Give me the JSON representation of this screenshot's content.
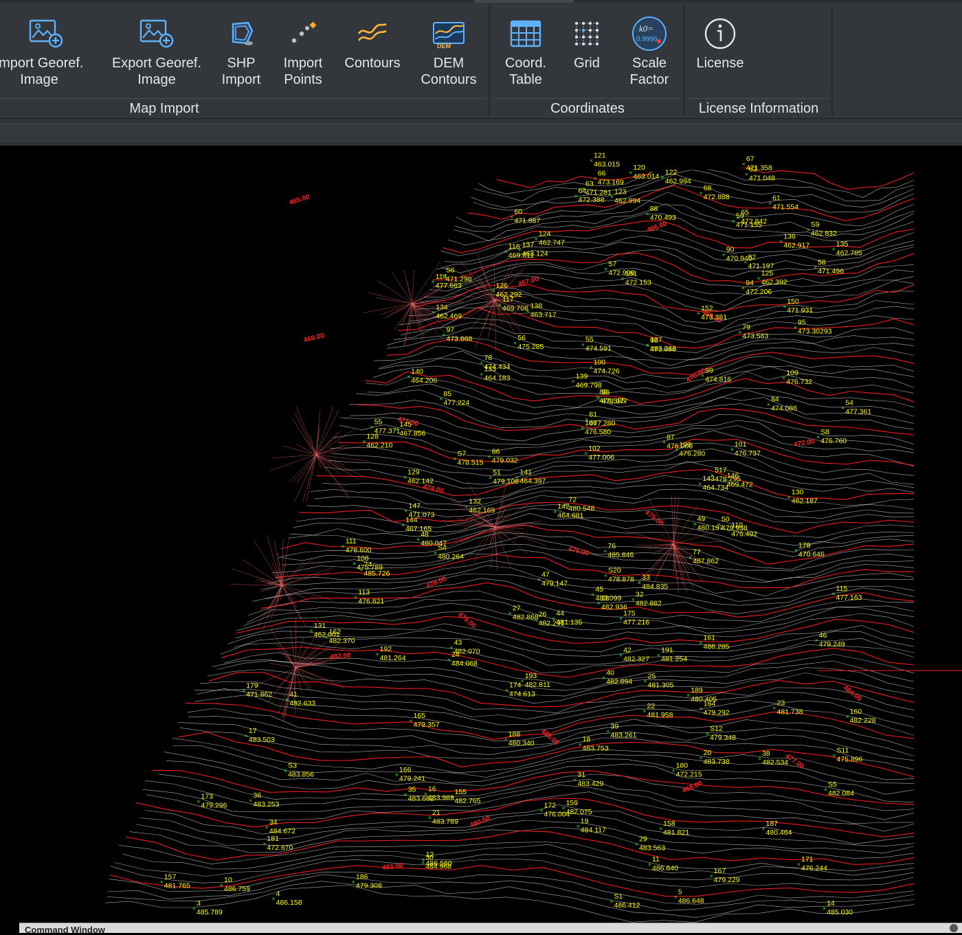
{
  "ribbon": {
    "map_import": {
      "group_label": "Map Import",
      "buttons": [
        {
          "label": "Import Georef.\nImage",
          "icon": "import-georef-image-icon"
        },
        {
          "label": "Export Georef.\nImage",
          "icon": "export-georef-image-icon"
        },
        {
          "label": "SHP\nImport",
          "icon": "shp-import-icon"
        },
        {
          "label": "Import\nPoints",
          "icon": "import-points-icon"
        },
        {
          "label": "Contours",
          "icon": "contours-icon"
        },
        {
          "label": "DEM\nContours",
          "icon": "dem-contours-icon",
          "badge": "DEM"
        }
      ]
    },
    "coordinates": {
      "group_label": "Coordinates",
      "buttons": [
        {
          "label": "Coord.\nTable",
          "icon": "table-icon"
        },
        {
          "label": "Grid",
          "icon": "grid-icon"
        },
        {
          "label": "Scale\nFactor",
          "icon": "scale-factor-icon",
          "badge_top": "k0=",
          "badge_bottom": "0.9996"
        }
      ]
    },
    "license": {
      "group_label": "License Information",
      "buttons": [
        {
          "label": "License",
          "icon": "info-icon"
        }
      ]
    }
  },
  "command_window": {
    "title": "Command Window"
  },
  "drawing": {
    "colors": {
      "point_label": "#ffff00",
      "contour_index": "#ff1f1f",
      "contour_minor": "#d9d9d9",
      "point_marker": "#22ff22",
      "background": "#000000"
    },
    "points": [
      {
        "id": "67",
        "elev": "471.358"
      },
      {
        "id": "121",
        "elev": "463.015"
      },
      {
        "id": "62",
        "elev": "471.048"
      },
      {
        "id": "122",
        "elev": "462.994"
      },
      {
        "id": "120",
        "elev": "463.014"
      },
      {
        "id": "66",
        "elev": "473.169"
      },
      {
        "id": "68",
        "elev": "472.888"
      },
      {
        "id": "63",
        "elev": "471.281"
      },
      {
        "id": "61",
        "elev": "471.554"
      },
      {
        "id": "123",
        "elev": "462.994"
      },
      {
        "id": "64",
        "elev": "472.388"
      },
      {
        "id": "88",
        "elev": "470.493"
      },
      {
        "id": "60",
        "elev": "471.887"
      },
      {
        "id": "59",
        "elev": "471.155"
      },
      {
        "id": "65",
        "elev": "472.842"
      },
      {
        "id": "124",
        "elev": "462.747"
      },
      {
        "id": "S9",
        "elev": "462.832"
      },
      {
        "id": "136",
        "elev": "462.917"
      },
      {
        "id": "135",
        "elev": "462.785"
      },
      {
        "id": "137",
        "elev": "463.124"
      },
      {
        "id": "116",
        "elev": "469.811"
      },
      {
        "id": "90",
        "elev": "470.940"
      },
      {
        "id": "58",
        "elev": "471.496"
      },
      {
        "id": "S6",
        "elev": "471.298"
      },
      {
        "id": "82",
        "elev": "471.197"
      },
      {
        "id": "57",
        "elev": "472.996"
      },
      {
        "id": "125",
        "elev": "462.392"
      },
      {
        "id": "151",
        "elev": "472.153"
      },
      {
        "id": "114",
        "elev": "477.663"
      },
      {
        "id": "94",
        "elev": "472.206"
      },
      {
        "id": "126",
        "elev": "462.292"
      },
      {
        "id": "134",
        "elev": "462.469"
      },
      {
        "id": "138",
        "elev": "463.717"
      },
      {
        "id": "117",
        "elev": "469.708"
      },
      {
        "id": "150",
        "elev": "471.931"
      },
      {
        "id": "152",
        "elev": "473.381"
      },
      {
        "id": "95",
        "elev": "473.30293"
      },
      {
        "id": "79",
        "elev": "473.583"
      },
      {
        "id": "56",
        "elev": "475.285"
      },
      {
        "id": "96",
        "elev": "473.058"
      },
      {
        "id": "97",
        "elev": "473.668"
      },
      {
        "id": "55",
        "elev": "474.591"
      },
      {
        "id": "127",
        "elev": "462.246"
      },
      {
        "id": "78",
        "elev": "474.434"
      },
      {
        "id": "100",
        "elev": "474.726"
      },
      {
        "id": "133",
        "elev": "464.183"
      },
      {
        "id": "139",
        "elev": "469.798"
      },
      {
        "id": "99",
        "elev": "474.816"
      },
      {
        "id": "109",
        "elev": "476.732"
      },
      {
        "id": "140",
        "elev": "464.206"
      },
      {
        "id": "98",
        "elev": "473.977"
      },
      {
        "id": "84",
        "elev": "474.086"
      },
      {
        "id": "80",
        "elev": "476.555"
      },
      {
        "id": "85",
        "elev": "477.224"
      },
      {
        "id": "81",
        "elev": "477.280"
      },
      {
        "id": "54",
        "elev": "477.361"
      },
      {
        "id": "55",
        "elev": "477.371"
      },
      {
        "id": "145",
        "elev": "467.856"
      },
      {
        "id": "S8",
        "elev": "476.760"
      },
      {
        "id": "106",
        "elev": "476.580"
      },
      {
        "id": "128",
        "elev": "462.210"
      },
      {
        "id": "103",
        "elev": "476.280"
      },
      {
        "id": "101",
        "elev": "476.737"
      },
      {
        "id": "87",
        "elev": "476.000"
      },
      {
        "id": "102",
        "elev": "477.006"
      },
      {
        "id": "86",
        "elev": "479.032"
      },
      {
        "id": "S7",
        "elev": "478.515"
      },
      {
        "id": "517",
        "elev": "478.295"
      },
      {
        "id": "141",
        "elev": "464.397"
      },
      {
        "id": "129",
        "elev": "462.142"
      },
      {
        "id": "146",
        "elev": "469.472"
      },
      {
        "id": "51",
        "elev": "479.108"
      },
      {
        "id": "143",
        "elev": "464.734"
      },
      {
        "id": "130",
        "elev": "462.187"
      },
      {
        "id": "72",
        "elev": "480.548"
      },
      {
        "id": "132",
        "elev": "462.169"
      },
      {
        "id": "142",
        "elev": "464.681"
      },
      {
        "id": "144",
        "elev": "467.165"
      },
      {
        "id": "147",
        "elev": "471.073"
      },
      {
        "id": "110",
        "elev": "476.492"
      },
      {
        "id": "50",
        "elev": "479.938"
      },
      {
        "id": "49",
        "elev": "480.197"
      },
      {
        "id": "48",
        "elev": "480.047"
      },
      {
        "id": "76",
        "elev": "485.846"
      },
      {
        "id": "S4",
        "elev": "480.264"
      },
      {
        "id": "111",
        "elev": "478.600"
      },
      {
        "id": "178",
        "elev": "470.646"
      },
      {
        "id": "108",
        "elev": "475.789"
      },
      {
        "id": "77",
        "elev": "487.862"
      },
      {
        "id": "74",
        "elev": "485.726"
      },
      {
        "id": "33",
        "elev": "484.835"
      },
      {
        "id": "47",
        "elev": "479.147"
      },
      {
        "id": "S20",
        "elev": "478.878"
      },
      {
        "id": "113",
        "elev": "476.821"
      },
      {
        "id": "32",
        "elev": "482.882"
      },
      {
        "id": "45",
        "elev": "480.099"
      },
      {
        "id": "115",
        "elev": "477.163"
      },
      {
        "id": "28",
        "elev": "482.936"
      },
      {
        "id": "27",
        "elev": "482.868"
      },
      {
        "id": "26",
        "elev": "482.291"
      },
      {
        "id": "175",
        "elev": "477.216"
      },
      {
        "id": "44",
        "elev": "481.135"
      },
      {
        "id": "46",
        "elev": "479.249"
      },
      {
        "id": "131",
        "elev": "462.001"
      },
      {
        "id": "162",
        "elev": "482.370"
      },
      {
        "id": "161",
        "elev": "486.285"
      },
      {
        "id": "43",
        "elev": "482.070"
      },
      {
        "id": "42",
        "elev": "482.327"
      },
      {
        "id": "192",
        "elev": "481.264"
      },
      {
        "id": "191",
        "elev": "481.254"
      },
      {
        "id": "24",
        "elev": "484.068"
      },
      {
        "id": "25",
        "elev": "481.305"
      },
      {
        "id": "193",
        "elev": "482.811"
      },
      {
        "id": "40",
        "elev": "482.894"
      },
      {
        "id": "174",
        "elev": "474.613"
      },
      {
        "id": "179",
        "elev": "471.862"
      },
      {
        "id": "189",
        "elev": "480.405"
      },
      {
        "id": "23",
        "elev": "481.738"
      },
      {
        "id": "22",
        "elev": "481.958"
      },
      {
        "id": "41",
        "elev": "482.633"
      },
      {
        "id": "165",
        "elev": "479.357"
      },
      {
        "id": "164",
        "elev": "479.292"
      },
      {
        "id": "160",
        "elev": "482.228"
      },
      {
        "id": "17",
        "elev": "483.503"
      },
      {
        "id": "39",
        "elev": "483.261"
      },
      {
        "id": "S12",
        "elev": "479.348"
      },
      {
        "id": "188",
        "elev": "480.340"
      },
      {
        "id": "18",
        "elev": "483.753"
      },
      {
        "id": "20",
        "elev": "483.738"
      },
      {
        "id": "38",
        "elev": "482.534"
      },
      {
        "id": "S11",
        "elev": "475.896"
      },
      {
        "id": "166",
        "elev": "479.241"
      },
      {
        "id": "31",
        "elev": "483.429"
      },
      {
        "id": "S3",
        "elev": "483.856"
      },
      {
        "id": "180",
        "elev": "472.215"
      },
      {
        "id": "S5",
        "elev": "482.084"
      },
      {
        "id": "155",
        "elev": "482.765"
      },
      {
        "id": "16",
        "elev": "483.989"
      },
      {
        "id": "35",
        "elev": "483.662"
      },
      {
        "id": "36",
        "elev": "483.253"
      },
      {
        "id": "172",
        "elev": "476.004"
      },
      {
        "id": "173",
        "elev": "479.296"
      },
      {
        "id": "159",
        "elev": "482.075"
      },
      {
        "id": "19",
        "elev": "484.117"
      },
      {
        "id": "21",
        "elev": "483.789"
      },
      {
        "id": "34",
        "elev": "484.672"
      },
      {
        "id": "187",
        "elev": "480.464"
      },
      {
        "id": "158",
        "elev": "481.821"
      },
      {
        "id": "181",
        "elev": "472.670"
      },
      {
        "id": "29",
        "elev": "483.563"
      },
      {
        "id": "30",
        "elev": "484.968"
      },
      {
        "id": "171",
        "elev": "476.244"
      },
      {
        "id": "12",
        "elev": "486.560"
      },
      {
        "id": "11",
        "elev": "486.640"
      },
      {
        "id": "167",
        "elev": "479.229"
      },
      {
        "id": "186",
        "elev": "479.308"
      },
      {
        "id": "157",
        "elev": "481.765"
      },
      {
        "id": "10",
        "elev": "486.759"
      },
      {
        "id": "5",
        "elev": "486.648"
      },
      {
        "id": "S1",
        "elev": "486.412"
      },
      {
        "id": "4",
        "elev": "486.158"
      },
      {
        "id": "3",
        "elev": "485.789"
      },
      {
        "id": "14",
        "elev": "485.030"
      }
    ],
    "contour_labels": [
      "465.00",
      "466.00",
      "467.00",
      "468.00",
      "469.00",
      "470.00",
      "471.00",
      "472.00",
      "474.00",
      "475.00",
      "476.00",
      "478.00",
      "479.00",
      "482.00",
      "484.00",
      "486.00",
      "477.00",
      "468.00",
      "480.00",
      "481.00"
    ]
  }
}
